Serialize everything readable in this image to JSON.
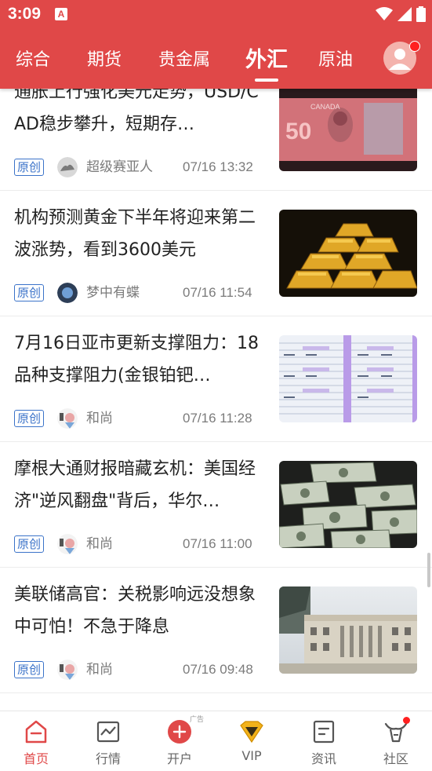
{
  "status_bar": {
    "time": "3:09",
    "app_badge": "A"
  },
  "tabs": [
    {
      "label": "综合",
      "active": false
    },
    {
      "label": "期货",
      "active": false
    },
    {
      "label": "贵金属",
      "active": false
    },
    {
      "label": "外汇",
      "active": true
    },
    {
      "label": "原油",
      "active": false
    }
  ],
  "articles": [
    {
      "title": "通胀上行强化美元走势，USD/CAD稳步攀升，短期存…",
      "badge": "原创",
      "author": "超级赛亚人",
      "time": "07/16 13:32",
      "thumb_icon": "canadian-50-banknote-image"
    },
    {
      "title": "机构预测黄金下半年将迎来第二波涨势，看到3600美元",
      "badge": "原创",
      "author": "梦中有蝶",
      "time": "07/16 11:54",
      "thumb_icon": "gold-bars-image"
    },
    {
      "title": "7月16日亚市更新支撑阻力：18品种支撑阻力(金银铂钯…",
      "badge": "原创",
      "author": "和尚",
      "time": "07/16 11:28",
      "thumb_icon": "support-resistance-table-image"
    },
    {
      "title": "摩根大通财报暗藏玄机：美国经济\"逆风翻盘\"背后，华尔…",
      "badge": "原创",
      "author": "和尚",
      "time": "07/16 11:00",
      "thumb_icon": "dollar-bills-image"
    },
    {
      "title": "美联储高官：关税影响远没想象中可怕！不急于降息",
      "badge": "原创",
      "author": "和尚",
      "time": "07/16 09:48",
      "thumb_icon": "federal-reserve-building-image"
    }
  ],
  "bottom_nav": [
    {
      "label": "首页",
      "icon": "home-icon",
      "active": true
    },
    {
      "label": "行情",
      "icon": "chart-icon",
      "active": false
    },
    {
      "label": "开户",
      "icon": "plus-circle-icon",
      "active": false,
      "tag": "广告"
    },
    {
      "label": "VIP",
      "icon": "vip-diamond-icon",
      "active": false
    },
    {
      "label": "资讯",
      "icon": "news-icon",
      "active": false
    },
    {
      "label": "社区",
      "icon": "community-icon",
      "active": false
    }
  ],
  "colors": {
    "brand_red": "#e04848",
    "badge_blue": "#3b73c9",
    "text_dark": "#222222",
    "text_gray": "#7b7b7b"
  }
}
